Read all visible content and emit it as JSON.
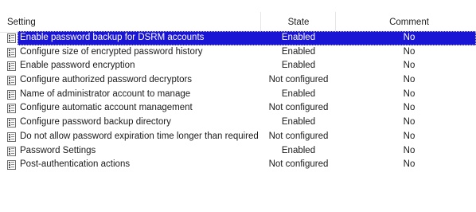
{
  "table": {
    "columns": {
      "setting": "Setting",
      "state": "State",
      "comment": "Comment"
    },
    "selected_row": 0,
    "rows": [
      {
        "setting": "Enable password backup for DSRM accounts",
        "state": "Enabled",
        "comment": "No"
      },
      {
        "setting": "Configure size of encrypted password history",
        "state": "Enabled",
        "comment": "No"
      },
      {
        "setting": "Enable password encryption",
        "state": "Enabled",
        "comment": "No"
      },
      {
        "setting": "Configure authorized password decryptors",
        "state": "Not configured",
        "comment": "No"
      },
      {
        "setting": "Name of administrator account to manage",
        "state": "Enabled",
        "comment": "No"
      },
      {
        "setting": "Configure automatic account management",
        "state": "Not configured",
        "comment": "No"
      },
      {
        "setting": "Configure password backup directory",
        "state": "Enabled",
        "comment": "No"
      },
      {
        "setting": "Do not allow password expiration time longer than required ...",
        "state": "Not configured",
        "comment": "No"
      },
      {
        "setting": "Password Settings",
        "state": "Enabled",
        "comment": "No"
      },
      {
        "setting": "Post-authentication actions",
        "state": "Not configured",
        "comment": "No"
      }
    ]
  },
  "icons": {
    "policy_setting": "policy-setting-icon"
  },
  "colors": {
    "selection_background": "#1a14d4",
    "selection_text": "#ffffff"
  }
}
